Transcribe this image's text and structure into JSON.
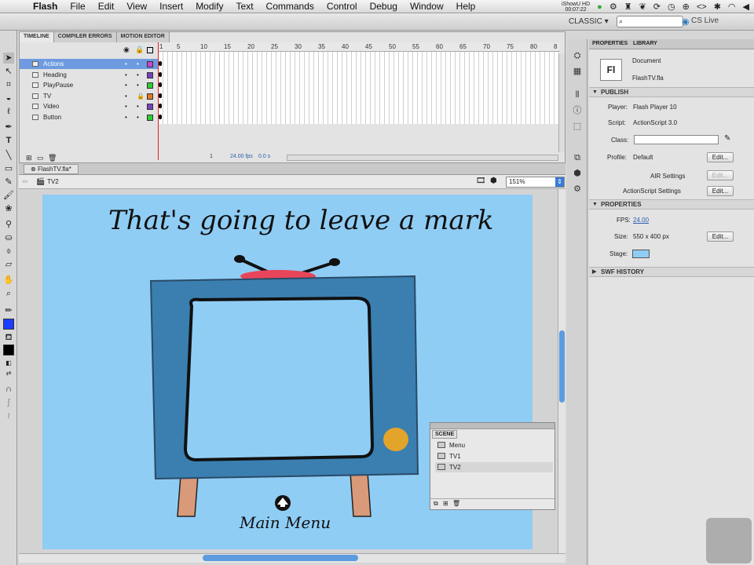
{
  "menubar": {
    "apple": "",
    "app": "Flash",
    "items": [
      "File",
      "Edit",
      "View",
      "Insert",
      "Modify",
      "Text",
      "Commands",
      "Control",
      "Debug",
      "Window",
      "Help"
    ],
    "recorder_name": "iShowU HD",
    "recorder_time": "00:07:22"
  },
  "appbar": {
    "workspace": "CLASSIC ▾",
    "search_placeholder": "",
    "cs_live": "CS Live"
  },
  "timeline": {
    "tabs": [
      "TIMELINE",
      "COMPILER ERRORS",
      "MOTION EDITOR"
    ],
    "ruler": [
      "1",
      "5",
      "10",
      "15",
      "20",
      "25",
      "30",
      "35",
      "40",
      "45",
      "50",
      "55",
      "60",
      "65",
      "70",
      "75",
      "80",
      "8"
    ],
    "layers": [
      {
        "name": "Actions",
        "color": "#cc44cc",
        "selected": true
      },
      {
        "name": "Heading",
        "color": "#7a3fbf",
        "selected": false
      },
      {
        "name": "PlayPause",
        "color": "#2ecc2e",
        "selected": false
      },
      {
        "name": "TV",
        "color": "#e07a20",
        "selected": false
      },
      {
        "name": "Video",
        "color": "#7a3fbf",
        "selected": false
      },
      {
        "name": "Button",
        "color": "#2ecc2e",
        "selected": false
      }
    ],
    "frame_number": "1",
    "fps": "24.00 fps",
    "time": "0.0 s"
  },
  "document": {
    "tab": "FlashTV.fla*",
    "scene": "TV2",
    "zoom": "151%"
  },
  "stage": {
    "heading": "That's going to leave a mark",
    "button_label": "Main Menu",
    "background": "#8fcdf5"
  },
  "scene_panel": {
    "title": "SCENE",
    "scenes": [
      {
        "name": "Menu",
        "selected": false
      },
      {
        "name": "TV1",
        "selected": false
      },
      {
        "name": "TV2",
        "selected": true
      }
    ]
  },
  "properties": {
    "tabs": [
      "PROPERTIES",
      "LIBRARY"
    ],
    "doc_type": "Document",
    "doc_icon": "Fl",
    "doc_name": "FlashTV.fla",
    "publish_title": "PUBLISH",
    "player_label": "Player:",
    "player_value": "Flash Player 10",
    "script_label": "Script:",
    "script_value": "ActionScript 3.0",
    "class_label": "Class:",
    "profile_label": "Profile:",
    "profile_value": "Default",
    "edit_label": "Edit...",
    "air_label": "AIR Settings",
    "as_label": "ActionScript Settings",
    "props_title": "PROPERTIES",
    "fps_label": "FPS:",
    "fps_value": "24.00",
    "size_label": "Size:",
    "size_value": "550 x 400 px",
    "stage_label": "Stage:",
    "stage_color": "#8fcdf5",
    "swf_history": "SWF HISTORY"
  }
}
